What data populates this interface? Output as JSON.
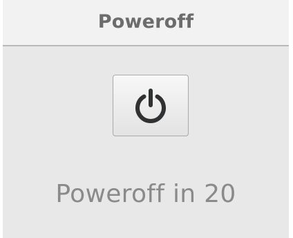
{
  "window": {
    "title": "Poweroff"
  },
  "power_button": {
    "icon": "power-icon"
  },
  "status": {
    "text": "Poweroff in 20"
  },
  "colors": {
    "dialog_background": "#e8e8e8",
    "titlebar_background": "#f2f2f2",
    "title_text": "#6c6c6c",
    "icon": "#2f3133",
    "status_text": "#8a8a8a"
  }
}
